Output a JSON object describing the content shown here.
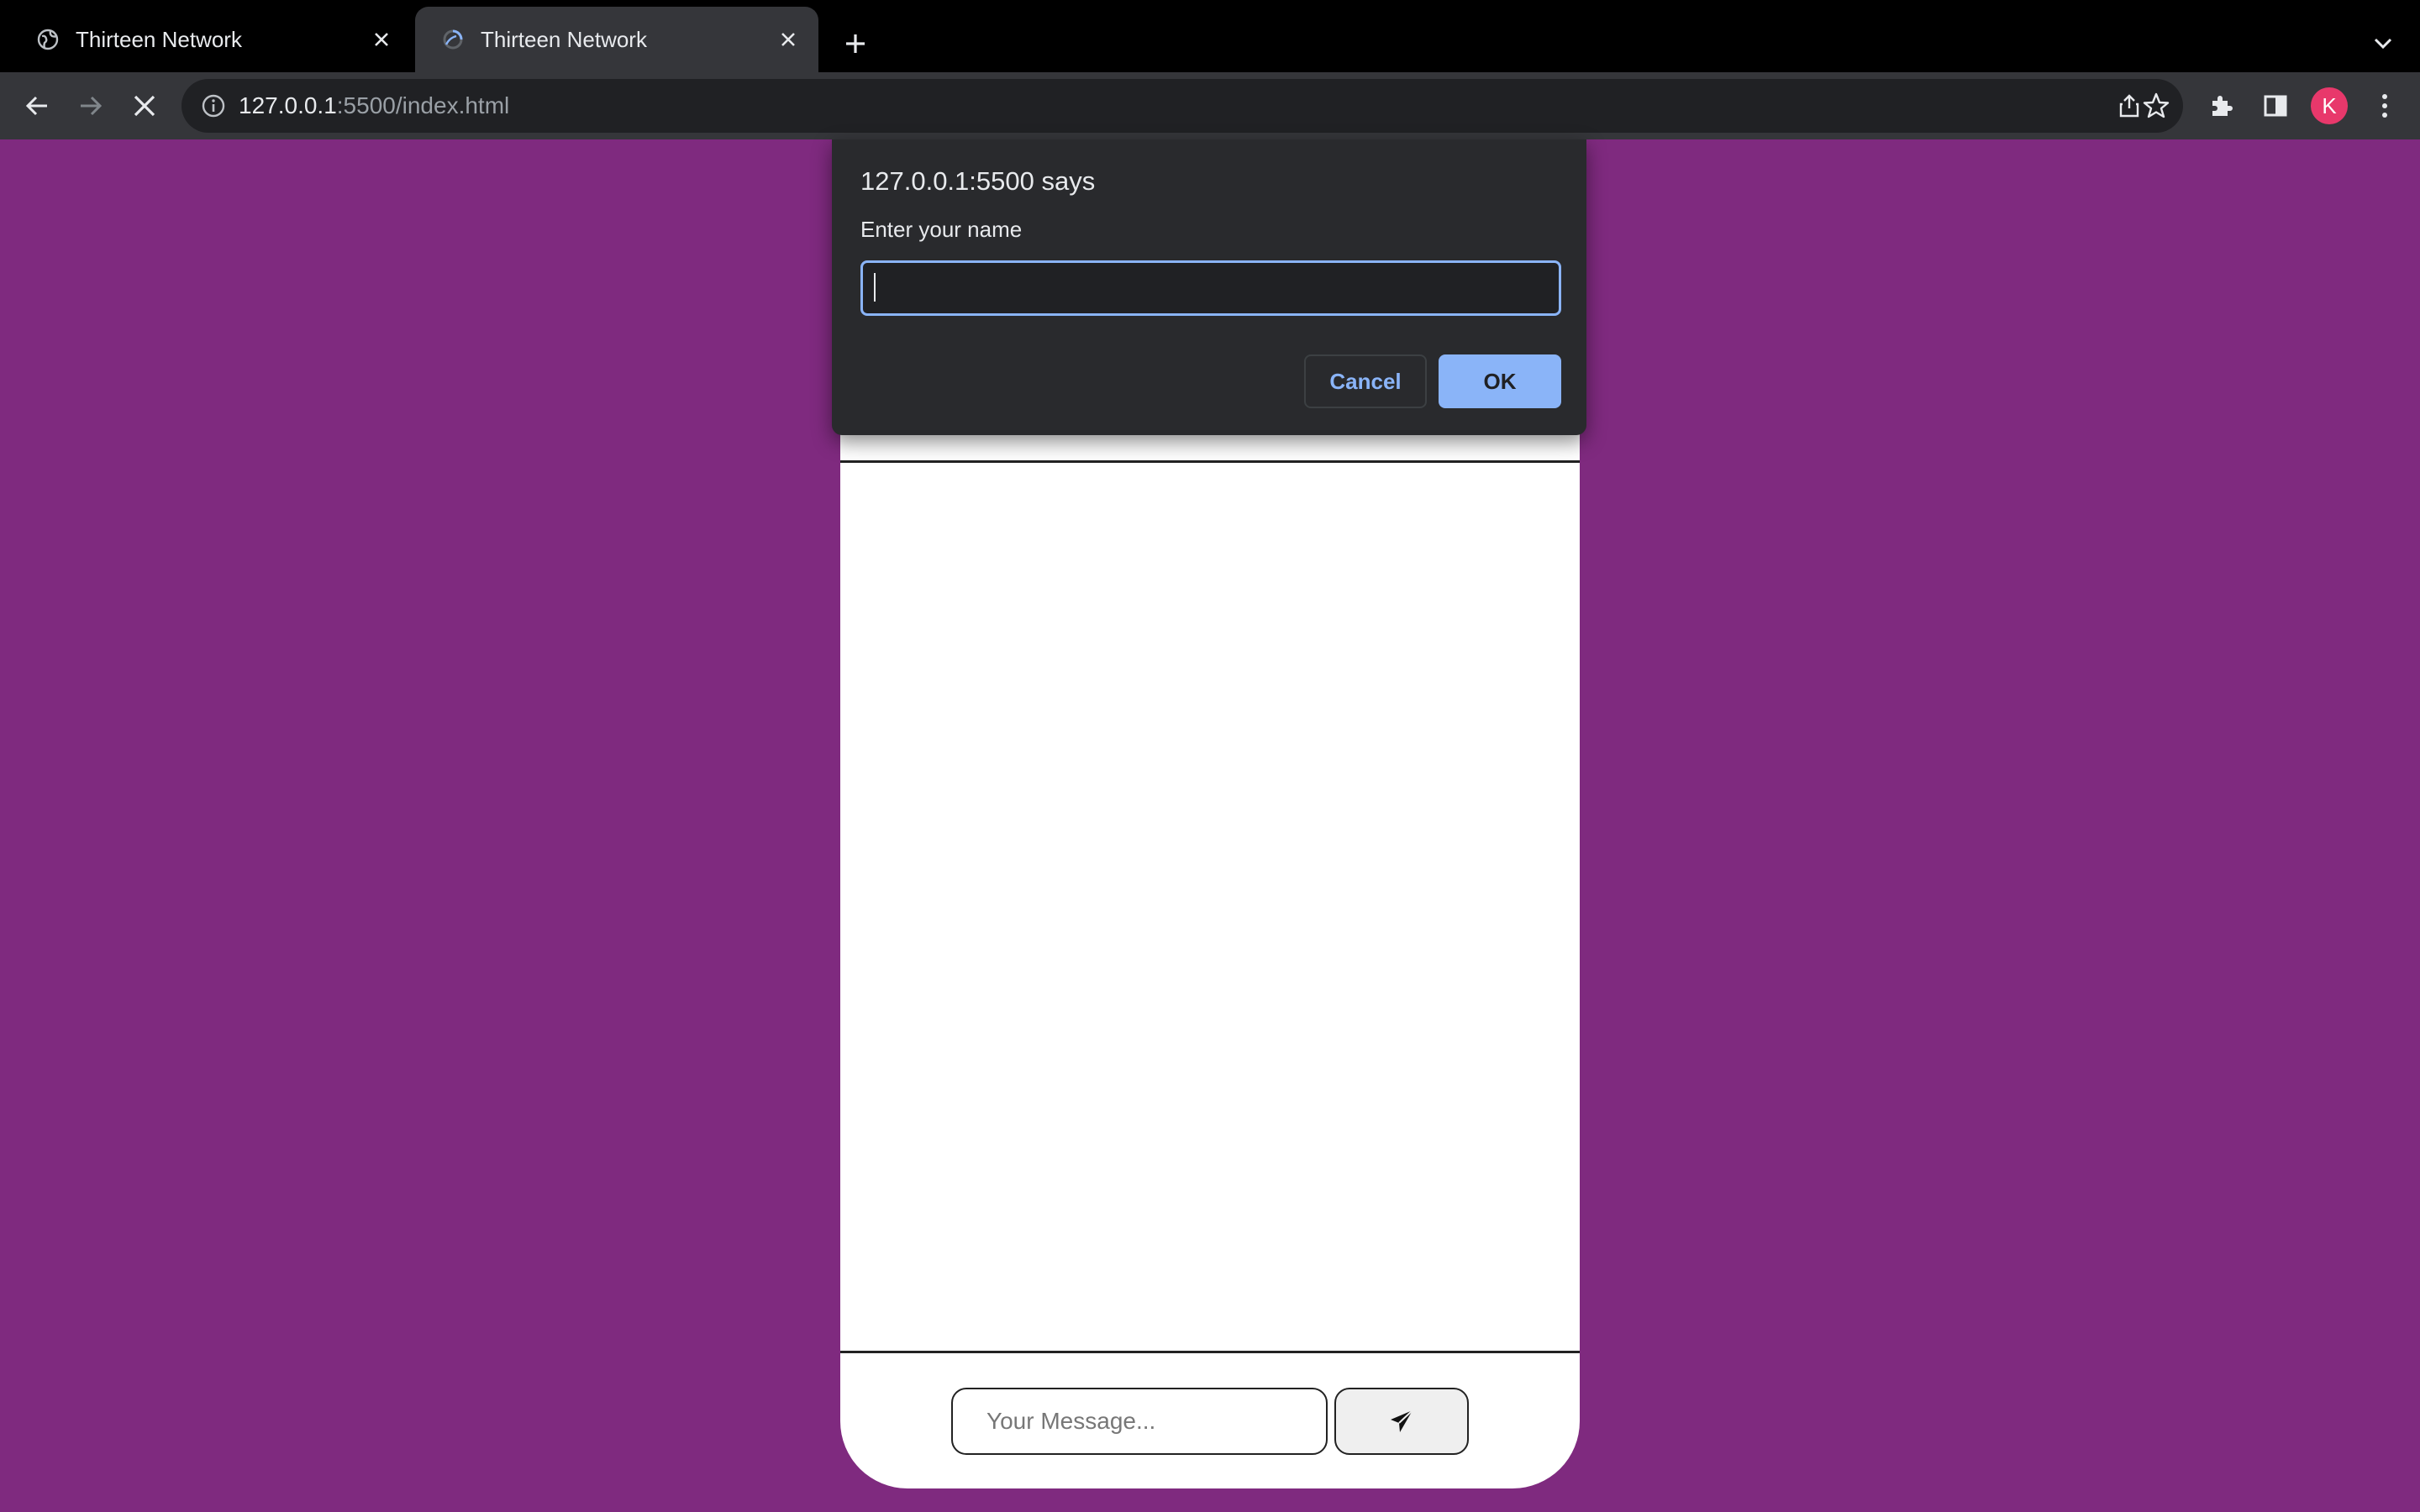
{
  "browser": {
    "tabs": [
      {
        "title": "Thirteen Network",
        "active": false,
        "favicon": "globe-icon"
      },
      {
        "title": "Thirteen Network",
        "active": true,
        "favicon": "loading-spinner-icon"
      }
    ],
    "address": {
      "host": "127.0.0.1",
      "rest": ":5500/index.html"
    },
    "profile_initial": "K",
    "colors": {
      "frame": "#000000",
      "toolbar": "#35363a",
      "omnibox": "#202124",
      "avatar": "#e8386b"
    }
  },
  "dialog": {
    "title": "127.0.0.1:5500 says",
    "message": "Enter your name",
    "input_value": "",
    "cancel_label": "Cancel",
    "ok_label": "OK",
    "colors": {
      "background": "#292a2d",
      "accent": "#8ab4f8"
    }
  },
  "page": {
    "background": "#7f2a7f",
    "message_placeholder": "Your Message...",
    "send_icon": "send-icon"
  }
}
